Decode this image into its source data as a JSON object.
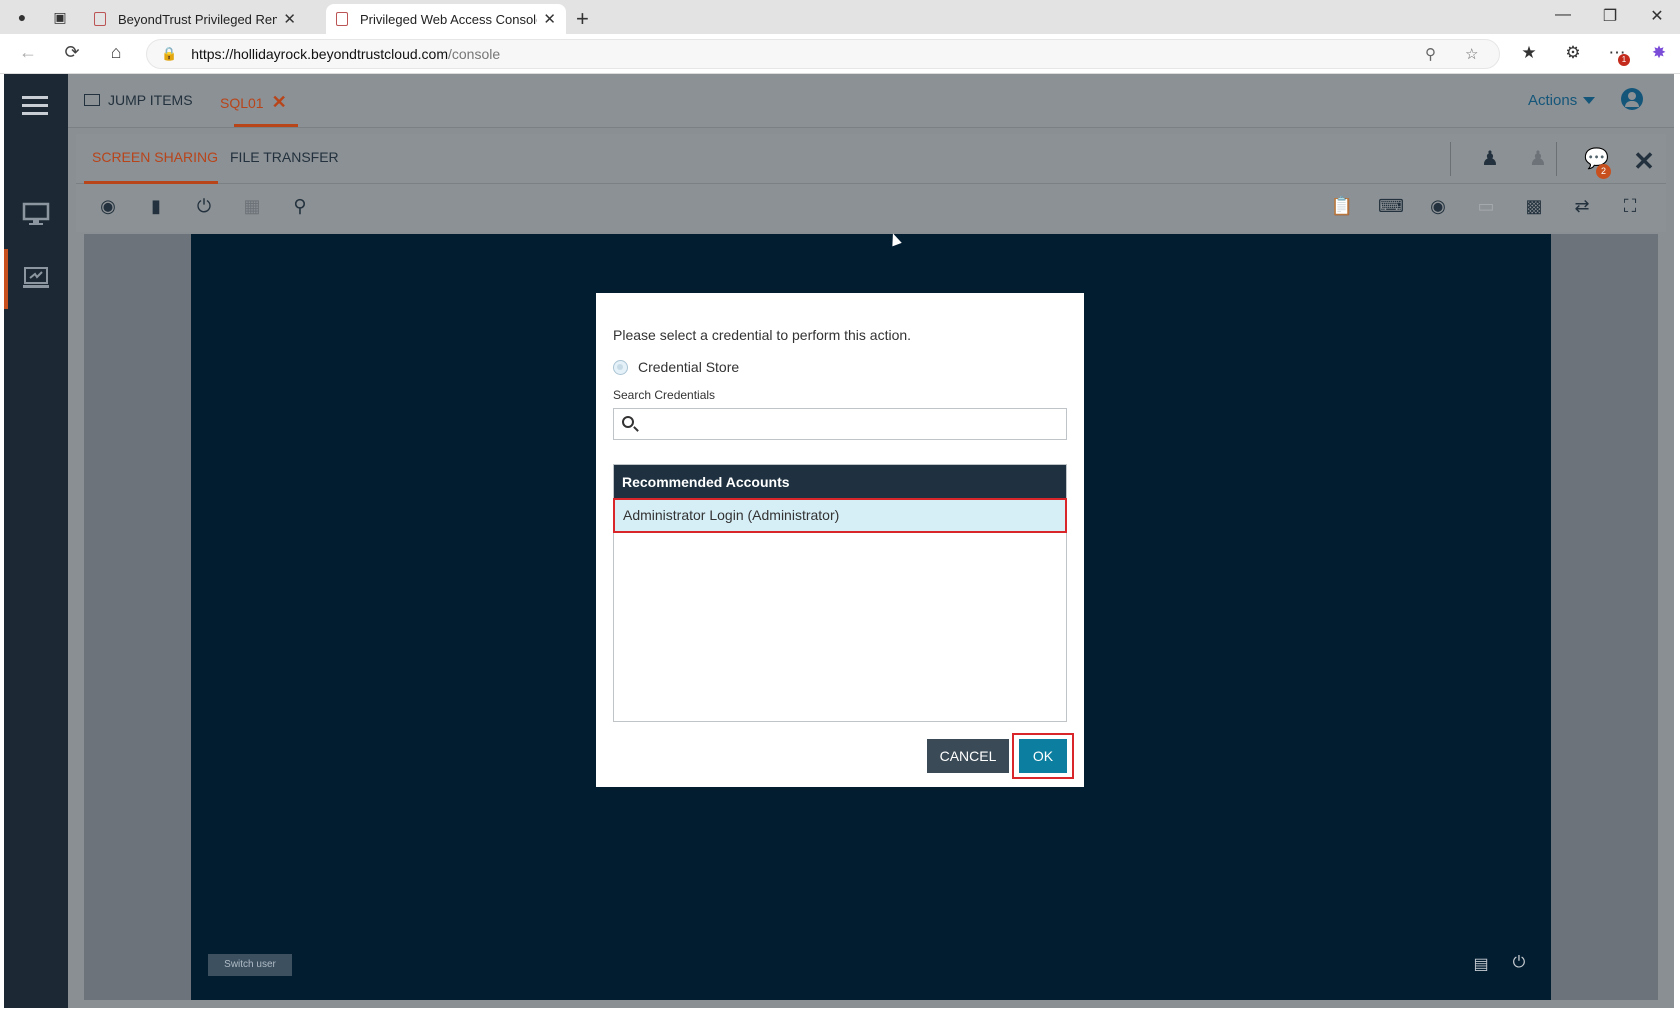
{
  "browser": {
    "tabs": [
      {
        "label": "BeyondTrust Privileged Remote A"
      },
      {
        "label": "Privileged Web Access Console - "
      }
    ],
    "url_host": "https://hollidayrock.beyondtrustcloud.com",
    "url_path": "/console",
    "notification_count": "1"
  },
  "topnav": {
    "jump_items": "JUMP ITEMS",
    "session_tab": "SQL01",
    "actions": "Actions"
  },
  "subnav": {
    "screen_sharing": "SCREEN SHARING",
    "file_transfer": "FILE TRANSFER",
    "chat_badge": "2"
  },
  "remote": {
    "switch_user": "Switch user"
  },
  "dialog": {
    "prompt": "Please select a credential to perform this action.",
    "radio_label": "Credential Store",
    "search_label": "Search Credentials",
    "search_value": "",
    "list_header": "Recommended Accounts",
    "accounts": [
      "Administrator Login (Administrator)"
    ],
    "cancel": "CANCEL",
    "ok": "OK"
  },
  "colors": {
    "accent": "#b8441a",
    "highlight": "#d9262b",
    "primary": "#0c7fa0",
    "remote_bg": "#021c30"
  }
}
